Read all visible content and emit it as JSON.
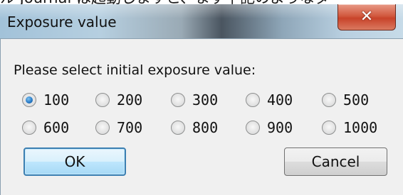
{
  "background": {
    "text": "ル Journal は起動しますと、まず下記のようなダ"
  },
  "dialog": {
    "title": "Exposure value",
    "close_icon": "close-icon",
    "prompt": "Please select initial exposure value:",
    "selected": "100",
    "options": [
      "100",
      "200",
      "300",
      "400",
      "500",
      "600",
      "700",
      "800",
      "900",
      "1000"
    ],
    "ok_label": "OK",
    "cancel_label": "Cancel",
    "colors": {
      "close_button": "#c8432a",
      "default_button_border": "#3c7fb1",
      "radio_checked": "#2a7cc8"
    }
  }
}
